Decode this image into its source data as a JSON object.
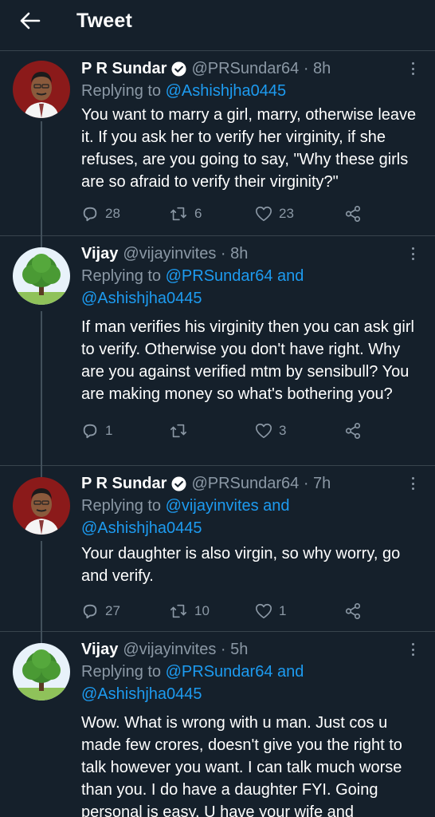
{
  "header": {
    "title": "Tweet"
  },
  "colors": {
    "background": "#15202b",
    "accent": "#1d9bf0",
    "muted": "#8b98a5"
  },
  "tweets": [
    {
      "name": "P R Sundar",
      "handle": "@PRSundar64 · 8h",
      "replying_prefix": "Replying to ",
      "mentions_line1": "@Ashishjha0445",
      "mentions_line2": "",
      "text": "You want to marry a girl, marry, otherwise leave it. If you ask her to verify her virginity, if she refuses, are you going to say, \"Why these girls are so afraid to verify their virginity?\"",
      "replies": "28",
      "retweets": "6",
      "likes": "23",
      "verified": true
    },
    {
      "name": "Vijay",
      "handle": "@vijayinvites · 8h",
      "replying_prefix": "Replying to ",
      "mentions_line1": "@PRSundar64 and",
      "mentions_line2": "@Ashishjha0445",
      "text": "If man verifies his virginity then you can ask girl to verify. Otherwise you don't have right. Why are you against verified mtm by sensibull? You are making money so what's bothering you?",
      "replies": "1",
      "retweets": "",
      "likes": "3",
      "verified": false
    },
    {
      "name": "P R Sundar",
      "handle": "@PRSundar64 · 7h",
      "replying_prefix": "Replying to ",
      "mentions_line1": "@vijayinvites and",
      "mentions_line2": "@Ashishjha0445",
      "text": "Your daughter is also virgin, so why worry, go and verify.",
      "replies": "27",
      "retweets": "10",
      "likes": "1",
      "verified": true
    },
    {
      "name": "Vijay",
      "handle": "@vijayinvites · 5h",
      "replying_prefix": "Replying to ",
      "mentions_line1": "@PRSundar64 and",
      "mentions_line2": "@Ashishjha0445",
      "text": "Wow. What is wrong with u man. Just cos u made few crores, doesn't give you the right to talk however you want. I can talk much worse than you. I do have a daughter FYI. Going personal is easy. U have your wife and",
      "verified": false
    }
  ]
}
